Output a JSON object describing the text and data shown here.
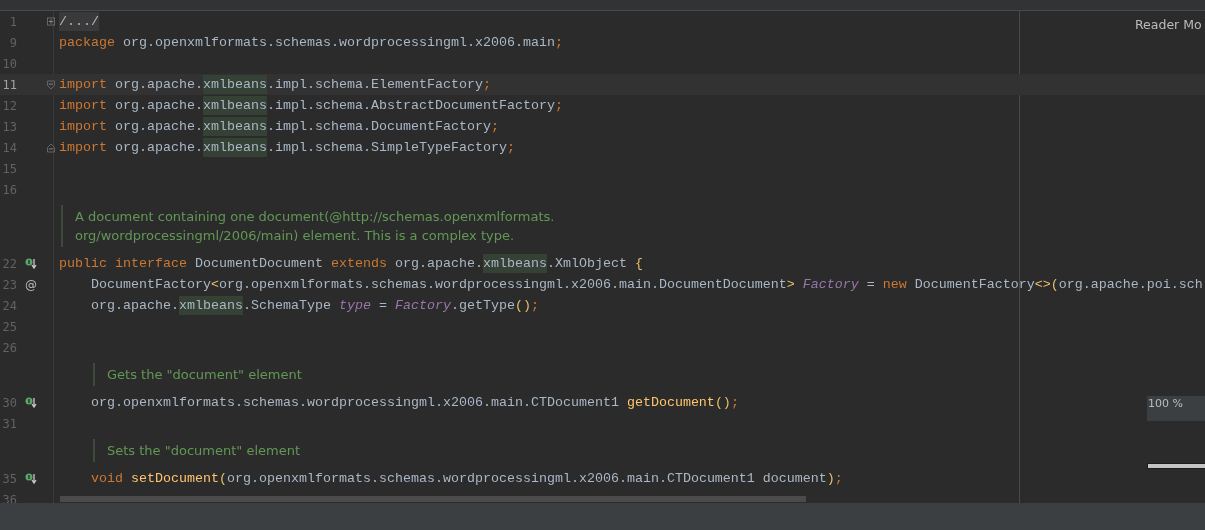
{
  "editor": {
    "reader_mode": "Reader Mo",
    "zoom_popup": "100 %",
    "lines": [
      {
        "kind": "code",
        "number": "1",
        "current": false,
        "fold": {
          "kind": "collapsed"
        },
        "tokens": [
          {
            "kind": "folded",
            "text": "/.../"
          }
        ]
      },
      {
        "kind": "code",
        "number": "9",
        "current": false,
        "tokens": [
          {
            "kind": "keyword",
            "text": "package "
          },
          {
            "kind": "plain",
            "text": "org.openxmlformats.schemas.wordprocessingml.x2006.main"
          },
          {
            "kind": "punct",
            "text": ";"
          }
        ]
      },
      {
        "kind": "code",
        "number": "10",
        "current": false
      },
      {
        "kind": "code",
        "number": "11",
        "current": true,
        "fold": {
          "kind": "start"
        },
        "tokens": [
          {
            "kind": "keyword",
            "text": "import "
          },
          {
            "kind": "plain",
            "text": "org.apache."
          },
          {
            "kind": "match",
            "text": "xmlbeans"
          },
          {
            "kind": "plain",
            "text": ".impl.schema.ElementFactory"
          },
          {
            "kind": "punct",
            "text": ";"
          }
        ]
      },
      {
        "kind": "code",
        "number": "12",
        "current": false,
        "tokens": [
          {
            "kind": "keyword",
            "text": "import "
          },
          {
            "kind": "plain",
            "text": "org.apache."
          },
          {
            "kind": "match",
            "text": "xmlbeans"
          },
          {
            "kind": "plain",
            "text": ".impl.schema.AbstractDocumentFactory"
          },
          {
            "kind": "punct",
            "text": ";"
          }
        ]
      },
      {
        "kind": "code",
        "number": "13",
        "current": false,
        "tokens": [
          {
            "kind": "keyword",
            "text": "import "
          },
          {
            "kind": "plain",
            "text": "org.apache."
          },
          {
            "kind": "match",
            "text": "xmlbeans"
          },
          {
            "kind": "plain",
            "text": ".impl.schema.DocumentFactory"
          },
          {
            "kind": "punct",
            "text": ";"
          }
        ]
      },
      {
        "kind": "code",
        "number": "14",
        "current": false,
        "fold": {
          "kind": "end"
        },
        "tokens": [
          {
            "kind": "keyword",
            "text": "import "
          },
          {
            "kind": "plain",
            "text": "org.apache."
          },
          {
            "kind": "match",
            "text": "xmlbeans"
          },
          {
            "kind": "plain",
            "text": ".impl.schema.SimpleTypeFactory"
          },
          {
            "kind": "punct",
            "text": ";"
          }
        ]
      },
      {
        "kind": "code",
        "number": "15",
        "current": false
      },
      {
        "kind": "code",
        "number": "16",
        "current": false
      },
      {
        "kind": "doc",
        "text": [
          "A document containing one document(@http://schemas.openxmlformats.",
          "org/wordprocessingml/2006/main) element. This is a complex type."
        ]
      },
      {
        "kind": "code",
        "number": "22",
        "current": false,
        "marker": {
          "kind": "implemented"
        },
        "tokens": [
          {
            "kind": "keyword",
            "text": "public interface "
          },
          {
            "kind": "plain",
            "text": "DocumentDocument "
          },
          {
            "kind": "keyword",
            "text": "extends "
          },
          {
            "kind": "plain",
            "text": "org.apache."
          },
          {
            "kind": "match",
            "text": "xmlbeans"
          },
          {
            "kind": "plain",
            "text": ".XmlObject "
          },
          {
            "kind": "bracket",
            "text": "{"
          }
        ],
        "children": [
          {
            "kind": "code",
            "number": "23",
            "current": false,
            "marker": {
              "kind": "annotation",
              "text": "@"
            },
            "tokens": [
              {
                "kind": "plain",
                "text": "DocumentFactory"
              },
              {
                "kind": "bracket",
                "text": "<"
              },
              {
                "kind": "plain",
                "text": "org.openxmlformats.schemas.wordprocessingml.x2006.main.DocumentDocument"
              },
              {
                "kind": "bracket",
                "text": "> "
              },
              {
                "kind": "field",
                "text": "Factory"
              },
              {
                "kind": "plain",
                "text": " = "
              },
              {
                "kind": "keyword",
                "text": "new "
              },
              {
                "kind": "plain",
                "text": "DocumentFactory"
              },
              {
                "kind": "bracket",
                "text": "<>("
              },
              {
                "kind": "plain",
                "text": "org.apache.poi.sch"
              }
            ]
          },
          {
            "kind": "code",
            "number": "24",
            "current": false,
            "tokens": [
              {
                "kind": "plain",
                "text": "org.apache."
              },
              {
                "kind": "match",
                "text": "xmlbeans"
              },
              {
                "kind": "plain",
                "text": ".SchemaType "
              },
              {
                "kind": "field",
                "text": "type"
              },
              {
                "kind": "plain",
                "text": " = "
              },
              {
                "kind": "field",
                "text": "Factory"
              },
              {
                "kind": "plain",
                "text": ".getType"
              },
              {
                "kind": "bracket",
                "text": "()"
              },
              {
                "kind": "punct",
                "text": ";"
              }
            ]
          },
          {
            "kind": "code",
            "number": "25",
            "current": false
          },
          {
            "kind": "code",
            "number": "26",
            "current": false
          },
          {
            "kind": "doc",
            "text": [
              "Gets the \"document\" element"
            ]
          },
          {
            "kind": "code",
            "number": "30",
            "current": false,
            "marker": {
              "kind": "implemented"
            },
            "tokens": [
              {
                "kind": "plain",
                "text": "org.openxmlformats.schemas.wordprocessingml.x2006.main.CTDocument1 "
              },
              {
                "kind": "method",
                "text": "getDocument"
              },
              {
                "kind": "bracket",
                "text": "()"
              },
              {
                "kind": "punct",
                "text": ";"
              }
            ]
          },
          {
            "kind": "code",
            "number": "31",
            "current": false
          },
          {
            "kind": "doc",
            "text": [
              "Sets the \"document\" element"
            ]
          },
          {
            "kind": "code",
            "number": "35",
            "current": false,
            "marker": {
              "kind": "implemented"
            },
            "tokens": [
              {
                "kind": "keyword",
                "text": "void "
              },
              {
                "kind": "method",
                "text": "setDocument"
              },
              {
                "kind": "bracket",
                "text": "("
              },
              {
                "kind": "plain",
                "text": "org.openxmlformats.schemas.wordprocessingml.x2006.main.CTDocument1 document"
              },
              {
                "kind": "bracket",
                "text": ")"
              },
              {
                "kind": "punct",
                "text": ";"
              }
            ]
          },
          {
            "kind": "code",
            "number": "36",
            "current": false
          }
        ]
      }
    ]
  }
}
